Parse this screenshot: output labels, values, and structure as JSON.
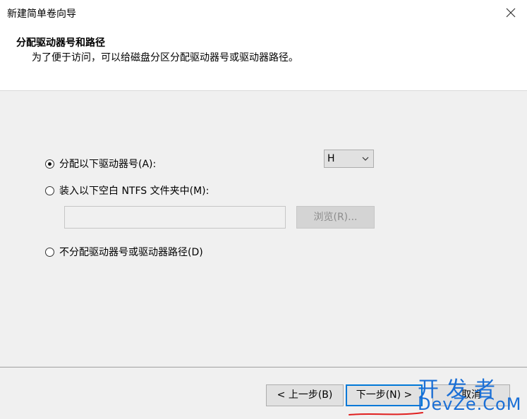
{
  "window": {
    "title": "新建简单卷向导"
  },
  "header": {
    "title": "分配驱动器号和路径",
    "subtitle": "为了便于访问，可以给磁盘分区分配驱动器号或驱动器路径。"
  },
  "options": {
    "assign_letter": {
      "label": "分配以下驱动器号(A):",
      "checked": true
    },
    "drive_letter_select": {
      "value": "H"
    },
    "mount_folder": {
      "label": "装入以下空白 NTFS 文件夹中(M):",
      "checked": false
    },
    "folder_path": {
      "value": ""
    },
    "browse_label": "浏览(R)...",
    "no_assign": {
      "label": "不分配驱动器号或驱动器路径(D)",
      "checked": false
    }
  },
  "footer": {
    "back_label": "< 上一步(B)",
    "next_label": "下一步(N) >",
    "cancel_label": "取消"
  },
  "watermark": {
    "cn": "开发者",
    "en": "DevZe.CoM"
  },
  "colors": {
    "accent": "#0078d7",
    "watermark": "#1a6fd6",
    "annotation": "#e02020"
  }
}
